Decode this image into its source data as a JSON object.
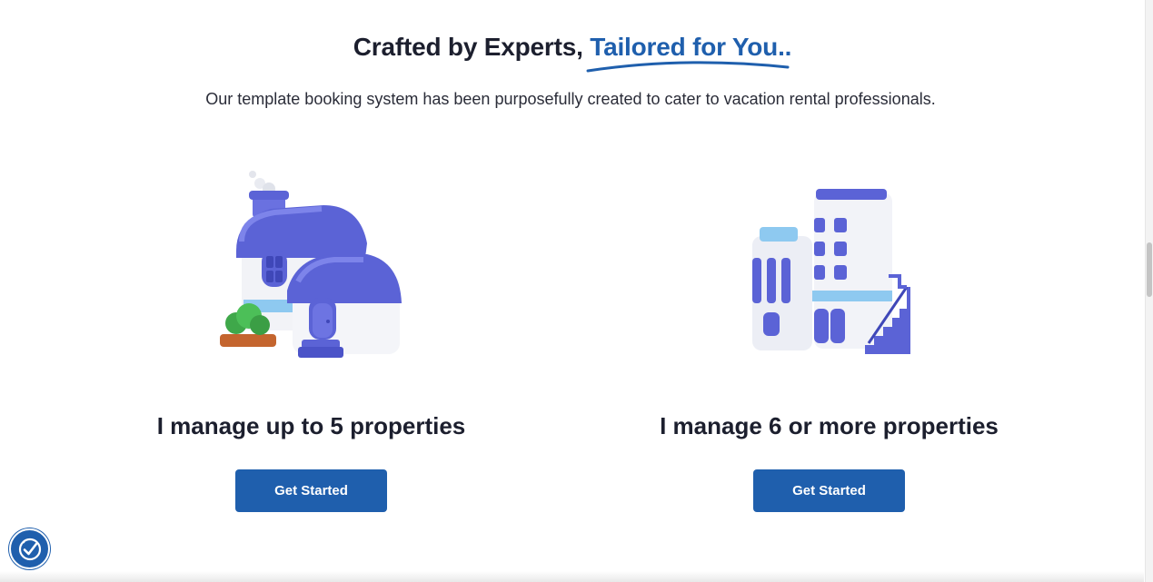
{
  "hero": {
    "title_part1": "Crafted by Experts, ",
    "title_accent": "Tailored for You..",
    "subtitle": "Our template booking system has been purposefully created to cater to vacation rental professionals."
  },
  "cards": [
    {
      "title": "I manage up to 5 properties",
      "button_label": "Get Started",
      "icon": "house-illustration"
    },
    {
      "title": "I manage 6 or more properties",
      "button_label": "Get Started",
      "icon": "apartment-building-illustration"
    }
  ],
  "colors": {
    "accent": "#1f5fad",
    "illustration_purple": "#5b63d6",
    "illustration_light_blue": "#8ec9f0"
  },
  "widgets": {
    "accessibility": "accessibility-icon"
  }
}
